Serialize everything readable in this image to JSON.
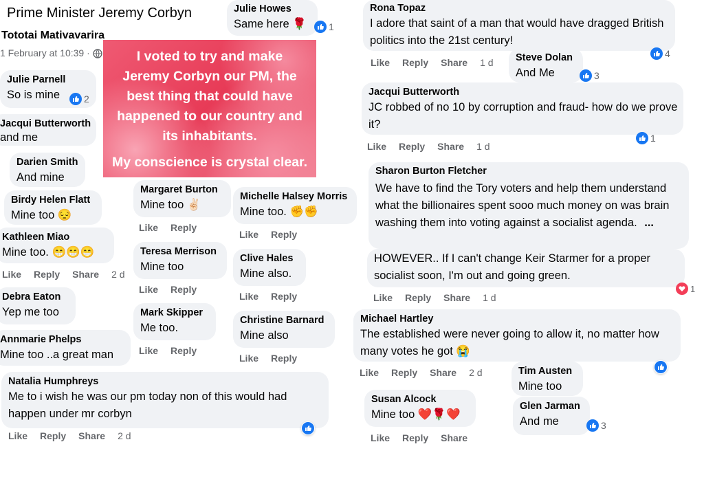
{
  "header": {
    "page_title": "Prime Minister Jeremy Corbyn",
    "author": "Tototai Mativavarira",
    "timestamp": "1 February at 10:39 ·"
  },
  "poster": {
    "lines": [
      "I voted to try and make",
      "Jeremy Corbyn our PM, the",
      "best thing that could have",
      "happened to our country and",
      "its inhabitants.",
      "My conscience is crystal clear."
    ]
  },
  "actions": {
    "like": "Like",
    "reply": "Reply",
    "share": "Share"
  },
  "comments": {
    "julie_parnell": {
      "name": "Julie Parnell",
      "text": "So is mine",
      "reactions": "2"
    },
    "jacqui_b_left": {
      "name": "Jacqui Butterworth",
      "text": "and me"
    },
    "darien_smith": {
      "name": "Darien Smith",
      "text": "And mine"
    },
    "birdy_flatt": {
      "name": "Birdy Helen Flatt",
      "text": "Mine too 😔"
    },
    "kathleen_miao": {
      "name": "Kathleen Miao",
      "text": "Mine too. 😁😁😁",
      "time": "2 d"
    },
    "debra_eaton": {
      "name": "Debra Eaton",
      "text": "Yep me too"
    },
    "annmarie_phelps": {
      "name": "Annmarie Phelps",
      "text": "Mine too ..a great man"
    },
    "natalia_humphreys": {
      "name": "Natalia Humphreys",
      "text": "Me to i wish he was our pm today non of this would had happen under mr corbyn",
      "time": "2 d"
    },
    "julie_howes": {
      "name": "Julie Howes",
      "text": "Same here 🌹",
      "reactions": "1"
    },
    "margaret_burton": {
      "name": "Margaret Burton",
      "text": "Mine too ✌🏻"
    },
    "teresa_merrison": {
      "name": "Teresa Merrison",
      "text": "Mine too"
    },
    "mark_skipper": {
      "name": "Mark Skipper",
      "text": "Me too."
    },
    "michelle_morris": {
      "name": "Michelle Halsey Morris",
      "text": "Mine too. ✊✊"
    },
    "clive_hales": {
      "name": "Clive Hales",
      "text": "Mine also."
    },
    "christine_barnard": {
      "name": "Christine Barnard",
      "text": "Mine also"
    },
    "rona_topaz": {
      "name": "Rona Topaz",
      "text": "I adore that saint of a man that would have dragged British politics into the 21st century!",
      "time": "1 d",
      "reactions": "4"
    },
    "steve_dolan": {
      "name": "Steve Dolan",
      "text": "And Me",
      "reactions": "3"
    },
    "jacqui_b_right": {
      "name": "Jacqui Butterworth",
      "text": "JC robbed of no 10 by corruption and fraud- how do we prove it?",
      "time": "1 d",
      "reactions": "1"
    },
    "sharon_fletcher": {
      "name": "Sharon Burton Fletcher",
      "text": "We have to find the Tory voters and help them understand what the billionaires spent sooo much money on was brain washing them into voting against a socialist agenda.",
      "more": "...",
      "text2": "HOWEVER.. If I can't change Keir Starmer for a proper socialist soon, I'm out and going green.",
      "time": "1 d",
      "reactions": "1"
    },
    "michael_hartley": {
      "name": "Michael Hartley",
      "text": "The established were never going to allow it, no matter how many votes he got 😭",
      "time": "2 d"
    },
    "tim_austen": {
      "name": "Tim Austen",
      "text": "Mine too"
    },
    "susan_alcock": {
      "name": "Susan Alcock",
      "text": "Mine too ❤️🌹❤️"
    },
    "glen_jarman": {
      "name": "Glen Jarman",
      "text": "And me",
      "reactions": "3"
    }
  },
  "colors": {
    "like_blue": "#1877f2",
    "love_red": "#f33e58",
    "bubble": "#f0f2f5",
    "meta": "#65676b"
  }
}
